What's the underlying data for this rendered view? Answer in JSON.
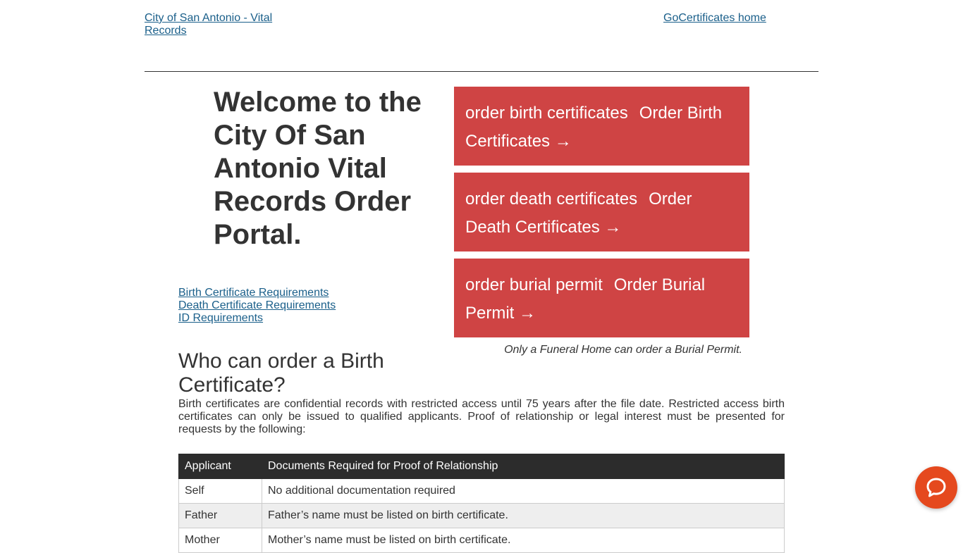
{
  "header": {
    "logo_left_alt": "City of San Antonio - Vital Records",
    "logo_right_alt": "GoCertificates home"
  },
  "welcome": {
    "title": "Welcome to the City Of San Antonio Vital Records Order Portal."
  },
  "requirement_links": [
    "Birth Certificate Requirements",
    "Death Certificate Requirements",
    "ID Requirements"
  ],
  "order_buttons": {
    "birth": {
      "img_alt": "order birth certificates",
      "label": "Order Birth Certificates →"
    },
    "death": {
      "img_alt": "order death certificates",
      "label": "Order Death Certificates →"
    },
    "burial": {
      "img_alt": "order burial permit",
      "label": "Order Burial Permit →"
    }
  },
  "burial_note": "Only a Funeral Home can order a Burial Permit.",
  "who_section": {
    "heading": "Who can order a Birth Certificate?",
    "paragraph": "Birth certificates are confidential records with restricted access until 75 years after the file date. Restricted access birth certificates can only be issued to qualified applicants. Proof of relationship or legal interest must be presented for requests by the following:"
  },
  "table": {
    "headers": [
      "Applicant",
      "Documents Required for Proof of Relationship"
    ],
    "rows": [
      [
        "Self",
        "No additional documentation required"
      ],
      [
        "Father",
        "Father’s name must be listed on birth certificate."
      ],
      [
        "Mother",
        "Mother’s name must be listed on birth certificate."
      ]
    ]
  },
  "colors": {
    "button_red": "#cf4444",
    "table_header": "#2c2c2c",
    "chat_orange": "#e5491e",
    "link_blue": "#1a5f8a"
  },
  "icons": {
    "chat": "chat-bubble-icon"
  }
}
